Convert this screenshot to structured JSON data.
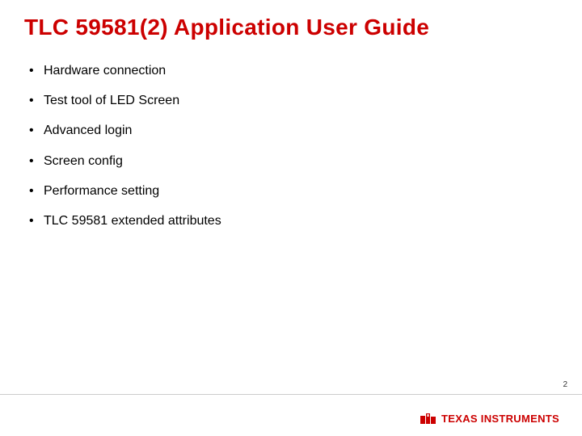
{
  "title": "TLC 59581(2) Application User Guide",
  "bullets": [
    "Hardware connection",
    "Test tool of LED Screen",
    "Advanced login",
    "Screen config",
    "Performance setting",
    "TLC 59581 extended attributes"
  ],
  "page_number": "2",
  "logo": {
    "text": "TEXAS INSTRUMENTS",
    "icon_name": "ti-logo-icon"
  }
}
